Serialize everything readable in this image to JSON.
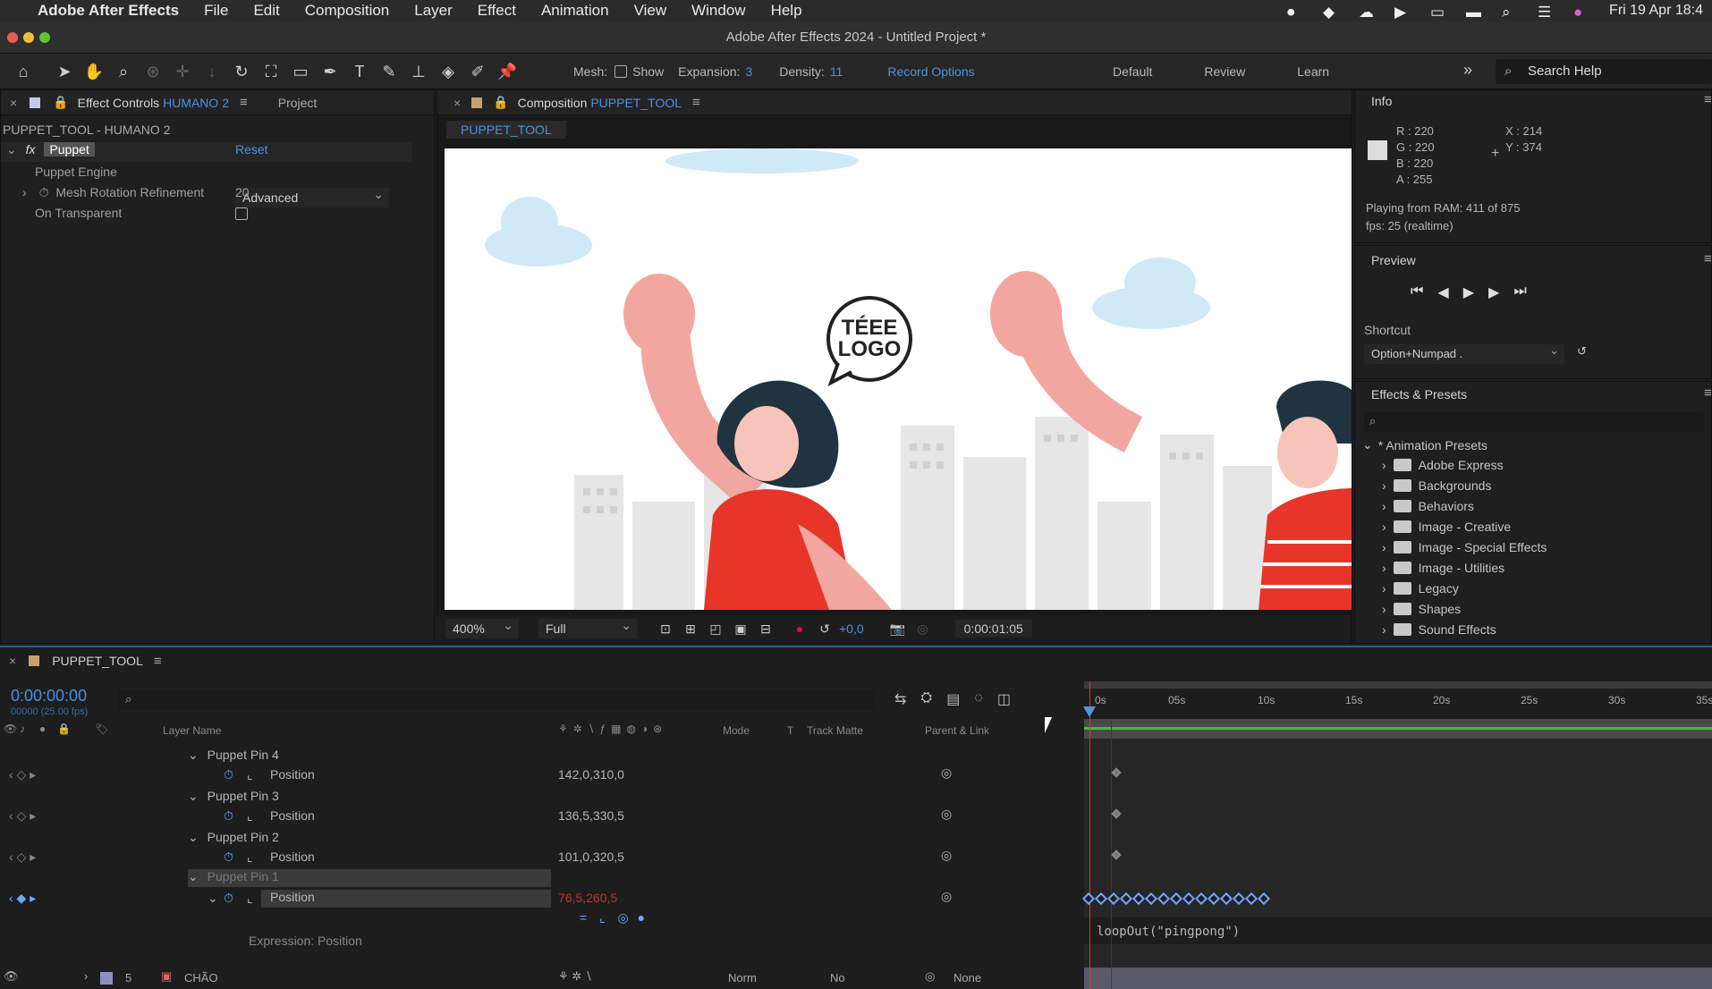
{
  "menubar": {
    "app": "Adobe After Effects",
    "items": [
      "File",
      "Edit",
      "Composition",
      "Layer",
      "Effect",
      "Animation",
      "View",
      "Window",
      "Help"
    ],
    "clock": "Fri 19 Apr  18:4"
  },
  "window": {
    "title": "Adobe After Effects 2024 - Untitled Project *"
  },
  "toolbar": {
    "mesh_label": "Mesh:",
    "show_label": "Show",
    "expansion_label": "Expansion:",
    "expansion_value": "3",
    "density_label": "Density:",
    "density_value": "11",
    "record_options": "Record Options",
    "workspaces": [
      "Default",
      "Review",
      "Learn"
    ],
    "search_placeholder": "Search Help"
  },
  "effect_controls": {
    "tab_label": "Effect Controls",
    "tab_layer": "HUMANO 2",
    "project_tab": "Project",
    "subtitle": "PUPPET_TOOL - HUMANO 2",
    "fx_label": "fx",
    "effect_name": "Puppet",
    "reset": "Reset",
    "engine_label": "Puppet Engine",
    "engine_value": "Advanced",
    "mesh_rot_label": "Mesh Rotation Refinement",
    "mesh_rot_value": "20",
    "on_transparent_label": "On Transparent"
  },
  "composition": {
    "tab_label": "Composition",
    "tab_name": "PUPPET_TOOL",
    "subtab": "PUPPET_TOOL",
    "bubble_text_1": "TÉEE",
    "bubble_text_2": "LOGO",
    "zoom": "400%",
    "resolution": "Full",
    "exposure": "+0,0",
    "timecode": "0:00:01:05"
  },
  "info": {
    "title": "Info",
    "r": "R : 220",
    "g": "G : 220",
    "b": "B : 220",
    "a": "A : 255",
    "x": "X : 214",
    "y": "Y : 374",
    "playing": "Playing from RAM: 411 of 875",
    "fps": "fps: 25 (realtime)"
  },
  "preview": {
    "title": "Preview",
    "shortcut_label": "Shortcut",
    "shortcut_value": "Option+Numpad ."
  },
  "effects_presets": {
    "title": "Effects & Presets",
    "root": "* Animation Presets",
    "folders": [
      "Adobe Express",
      "Backgrounds",
      "Behaviors",
      "Image - Creative",
      "Image - Special Effects",
      "Image - Utilities",
      "Legacy",
      "Shapes",
      "Sound Effects"
    ]
  },
  "timeline": {
    "tab_name": "PUPPET_TOOL",
    "timecode": "0:00:00:00",
    "frames": "00000 (25.00 fps)",
    "col_layer_name": "Layer Name",
    "col_mode": "Mode",
    "col_t": "T",
    "col_track_matte": "Track Matte",
    "col_parent": "Parent & Link",
    "pins": [
      {
        "name": "Puppet Pin 4",
        "prop": "Position",
        "value": "142,0,310,0"
      },
      {
        "name": "Puppet Pin 3",
        "prop": "Position",
        "value": "136,5,330,5"
      },
      {
        "name": "Puppet Pin 2",
        "prop": "Position",
        "value": "101,0,320,5"
      },
      {
        "name": "Puppet Pin 1",
        "prop": "Position",
        "value": "76,5,260,5"
      }
    ],
    "expression_label": "Expression: Position",
    "expression_code": "loopOut(\"pingpong\")",
    "layer5_num": "5",
    "layer5_name": "CHÃO",
    "layer5_mode": "Norm",
    "layer5_matte": "No",
    "layer5_parent": "None",
    "ruler": [
      "0s",
      "05s",
      "10s",
      "15s",
      "20s",
      "25s",
      "30s",
      "35s"
    ]
  },
  "colors": {
    "accent_blue": "#4a90e2",
    "keyframe_blue": "#6ea6ff",
    "work_area_green": "#3fbf3f",
    "playhead_red": "#d33"
  }
}
